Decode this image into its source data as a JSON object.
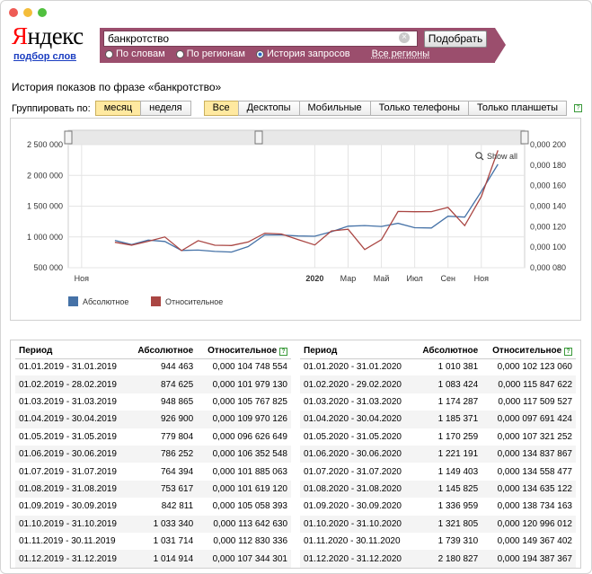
{
  "brand": {
    "logo_first": "Я",
    "logo_rest": "ндекс",
    "sublink": "подбор слов"
  },
  "search": {
    "query": "банкротство",
    "submit_label": "Подобрать",
    "modes": [
      {
        "label": "По словам",
        "selected": false
      },
      {
        "label": "По регионам",
        "selected": false
      },
      {
        "label": "История запросов",
        "selected": true
      }
    ],
    "regions_link": "Все регионы"
  },
  "page_title": "История показов по фразе «банкротство»",
  "groupby": {
    "label": "Группировать по:",
    "periods": [
      {
        "label": "месяц",
        "selected": true
      },
      {
        "label": "неделя",
        "selected": false
      }
    ],
    "devices": [
      {
        "label": "Все",
        "selected": true
      },
      {
        "label": "Десктопы",
        "selected": false
      },
      {
        "label": "Мобильные",
        "selected": false
      },
      {
        "label": "Только телефоны",
        "selected": false
      },
      {
        "label": "Только планшеты",
        "selected": false
      }
    ],
    "help": "?"
  },
  "chart_data": {
    "type": "line",
    "show_all": "Show all",
    "x_ticks": [
      "Ноя",
      "2020",
      "Мар",
      "Май",
      "Июл",
      "Сен",
      "Ноя"
    ],
    "y_left_ticks": [
      "2 500 000",
      "2 000 000",
      "1 500 000",
      "1 000 000",
      "500 000"
    ],
    "y_right_ticks": [
      "0,000 200",
      "0,000 180",
      "0,000 160",
      "0,000 140",
      "0,000 120",
      "0,000 100",
      "0,000 080"
    ],
    "ylim_left": [
      500000,
      2500000
    ],
    "ylim_right": [
      8e-05,
      0.0002
    ],
    "grid": true,
    "legend_position": "bottom-left",
    "colors": {
      "absolute": "#4572a7",
      "relative": "#aa4643"
    },
    "series": [
      {
        "name": "Абсолютное",
        "values": [
          944463,
          874625,
          948865,
          926900,
          779804,
          786252,
          764394,
          753617,
          842811,
          1033340,
          1031714,
          1014914,
          1010381,
          1083424,
          1174287,
          1185371,
          1170259,
          1221191,
          1149403,
          1145825,
          1336959,
          1321805,
          1739310,
          2180827
        ]
      },
      {
        "name": "Относительное",
        "values": [
          0.000104748554,
          0.00010197913,
          0.000105767825,
          0.000109970126,
          9.6626649e-05,
          0.000106352548,
          0.000101885063,
          0.00010161912,
          0.000105058393,
          0.00011364263,
          0.000112830336,
          0.000107344301,
          0.00010212306,
          0.000115847622,
          0.000117509527,
          9.7691424e-05,
          0.000107321252,
          0.000134837867,
          0.000134558477,
          0.000134635122,
          0.000138734163,
          0.000120996012,
          0.000149367402,
          0.000194387367
        ]
      }
    ]
  },
  "table": {
    "headers": {
      "period": "Период",
      "absolute": "Абсолютное",
      "relative": "Относительное"
    },
    "left": [
      [
        "01.01.2019 - 31.01.2019",
        "944 463",
        "0,000 104 748 554"
      ],
      [
        "01.02.2019 - 28.02.2019",
        "874 625",
        "0,000 101 979 130"
      ],
      [
        "01.03.2019 - 31.03.2019",
        "948 865",
        "0,000 105 767 825"
      ],
      [
        "01.04.2019 - 30.04.2019",
        "926 900",
        "0,000 109 970 126"
      ],
      [
        "01.05.2019 - 31.05.2019",
        "779 804",
        "0,000 096 626 649"
      ],
      [
        "01.06.2019 - 30.06.2019",
        "786 252",
        "0,000 106 352 548"
      ],
      [
        "01.07.2019 - 31.07.2019",
        "764 394",
        "0,000 101 885 063"
      ],
      [
        "01.08.2019 - 31.08.2019",
        "753 617",
        "0,000 101 619 120"
      ],
      [
        "01.09.2019 - 30.09.2019",
        "842 811",
        "0,000 105 058 393"
      ],
      [
        "01.10.2019 - 31.10.2019",
        "1 033 340",
        "0,000 113 642 630"
      ],
      [
        "01.11.2019 - 30.11.2019",
        "1 031 714",
        "0,000 112 830 336"
      ],
      [
        "01.12.2019 - 31.12.2019",
        "1 014 914",
        "0,000 107 344 301"
      ]
    ],
    "right": [
      [
        "01.01.2020 - 31.01.2020",
        "1 010 381",
        "0,000 102 123 060"
      ],
      [
        "01.02.2020 - 29.02.2020",
        "1 083 424",
        "0,000 115 847 622"
      ],
      [
        "01.03.2020 - 31.03.2020",
        "1 174 287",
        "0,000 117 509 527"
      ],
      [
        "01.04.2020 - 30.04.2020",
        "1 185 371",
        "0,000 097 691 424"
      ],
      [
        "01.05.2020 - 31.05.2020",
        "1 170 259",
        "0,000 107 321 252"
      ],
      [
        "01.06.2020 - 30.06.2020",
        "1 221 191",
        "0,000 134 837 867"
      ],
      [
        "01.07.2020 - 31.07.2020",
        "1 149 403",
        "0,000 134 558 477"
      ],
      [
        "01.08.2020 - 31.08.2020",
        "1 145 825",
        "0,000 134 635 122"
      ],
      [
        "01.09.2020 - 30.09.2020",
        "1 336 959",
        "0,000 138 734 163"
      ],
      [
        "01.10.2020 - 31.10.2020",
        "1 321 805",
        "0,000 120 996 012"
      ],
      [
        "01.11.2020 - 30.11.2020",
        "1 739 310",
        "0,000 149 367 402"
      ],
      [
        "01.12.2020 - 31.12.2020",
        "2 180 827",
        "0,000 194 387 367"
      ]
    ]
  }
}
